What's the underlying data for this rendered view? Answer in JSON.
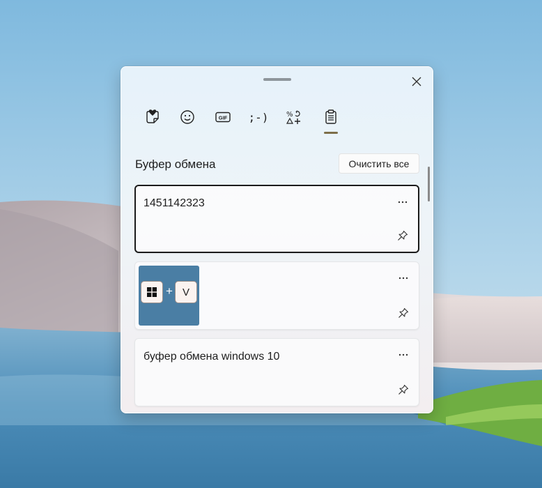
{
  "clipboard": {
    "title": "Буфер обмена",
    "clear_all_label": "Очистить все"
  },
  "tabs": [
    {
      "icon": "favorites-sticker-icon",
      "active": false
    },
    {
      "icon": "emoji-icon",
      "active": false
    },
    {
      "icon": "gif-icon",
      "active": false,
      "glyph": "GIF"
    },
    {
      "icon": "kaomoji-icon",
      "active": false,
      "glyph": ";-)"
    },
    {
      "icon": "symbols-icon",
      "active": false
    },
    {
      "icon": "clipboard-icon",
      "active": true
    }
  ],
  "items": [
    {
      "type": "text",
      "text": "1451142323",
      "selected": true
    },
    {
      "type": "image",
      "image": {
        "keys": [
          "windows-logo-key",
          "V"
        ],
        "plus": "+"
      }
    },
    {
      "type": "text",
      "text": "буфер обмена windows 10"
    }
  ],
  "colors": {
    "accent_indicator": "#7d6e49",
    "thumbnail_bg": "#4a7ea4"
  }
}
